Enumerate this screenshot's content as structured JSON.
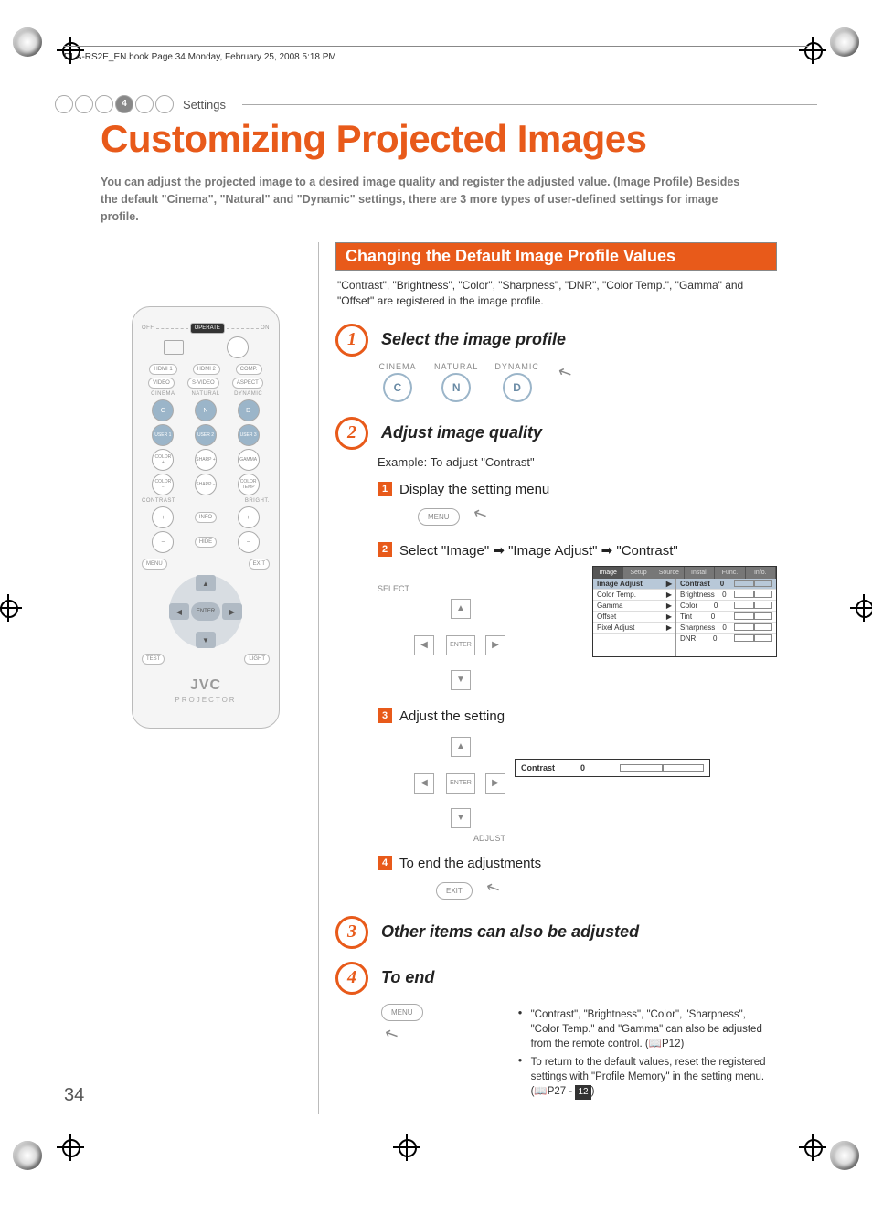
{
  "header": {
    "book_info": "DLA-RS2E_EN.book  Page 34  Monday, February 25, 2008  5:18 PM",
    "section_num": "4",
    "section_label": "Settings"
  },
  "title": "Customizing Projected Images",
  "intro": "You can adjust the projected image to a desired image quality and register the adjusted value. (Image Profile)  Besides the default \"Cinema\", \"Natural\" and \"Dynamic\" settings, there are 3 more types of user-defined settings for image profile.",
  "section_heading": "Changing the Default Image Profile Values",
  "section_desc": "\"Contrast\", \"Brightness\", \"Color\", \"Sharpness\", \"DNR\", \"Color Temp.\", \"Gamma\" and \"Offset\" are registered in the image profile.",
  "steps": {
    "s1": {
      "title": "Select the image profile",
      "labels": {
        "cinema": "CINEMA",
        "natural": "NATURAL",
        "dynamic": "DYNAMIC"
      },
      "buttons": {
        "c": "C",
        "n": "N",
        "d": "D"
      }
    },
    "s2": {
      "title": "Adjust image quality",
      "example": "Example: To adjust \"Contrast\"",
      "sub1": "Display the setting menu",
      "sub2_pre": "Select \"Image\"",
      "sub2_mid1": "\"Image Adjust\"",
      "sub2_mid2": "\"Contrast\"",
      "sub3": "Adjust the setting",
      "sub4": "To end the adjustments",
      "menu_btn": "MENU",
      "exit_btn": "EXIT",
      "enter_btn": "ENTER",
      "select_label": "SELECT",
      "adjust_label": "ADJUST"
    },
    "s3": {
      "title": "Other items can also be adjusted"
    },
    "s4": {
      "title": "To end"
    }
  },
  "menu_screenshot": {
    "tabs": [
      "Image",
      "Setup",
      "Source",
      "Install",
      "Func.",
      "Info."
    ],
    "left_items": [
      "Image Adjust",
      "Color Temp.",
      "Gamma",
      "Offset",
      "Pixel Adjust"
    ],
    "right_items": [
      {
        "name": "Contrast",
        "val": "0"
      },
      {
        "name": "Brightness",
        "val": "0"
      },
      {
        "name": "Color",
        "val": "0"
      },
      {
        "name": "Tint",
        "val": "0"
      },
      {
        "name": "Sharpness",
        "val": "0"
      },
      {
        "name": "DNR",
        "val": "0"
      }
    ]
  },
  "contrast_bar": {
    "label": "Contrast",
    "value": "0"
  },
  "notes": {
    "n1a": "\"Contrast\", \"Brightness\", \"Color\", \"Sharpness\", \"Color Temp.\" and \"Gamma\" can also be adjusted from the remote control. (",
    "n1b": "P12",
    "n1c": ")",
    "n2a": "To return to the default values, reset the registered settings with \"Profile Memory\" in the setting menu. (",
    "n2b": "P27",
    "n2c": " - ",
    "n2d": "12",
    "n2e": ")"
  },
  "remote": {
    "off": "OFF",
    "operate": "OPERATE",
    "on": "ON",
    "row1": [
      "HDMI 1",
      "HDMI 2",
      "COMP."
    ],
    "row2": [
      "VIDEO",
      "S-VIDEO",
      "ASPECT"
    ],
    "row3_labels": [
      "CINEMA",
      "NATURAL",
      "DYNAMIC"
    ],
    "row3": [
      "C",
      "N",
      "D"
    ],
    "row4": [
      "USER 1",
      "USER 2",
      "USER 3"
    ],
    "row5": [
      "COLOR +",
      "SHARP +",
      "GAMMA"
    ],
    "row6": [
      "COLOR −",
      "SHARP −",
      "COLOR TEMP"
    ],
    "contrast_label": "CONTRAST",
    "bright_label": "BRIGHT.",
    "info": "INFO",
    "hide": "HIDE",
    "menu": "MENU",
    "exit": "EXIT",
    "test": "TEST",
    "light": "LIGHT",
    "enter": "ENTER",
    "brand": "JVC",
    "brand_sub": "PROJECTOR"
  },
  "page_number": "34"
}
